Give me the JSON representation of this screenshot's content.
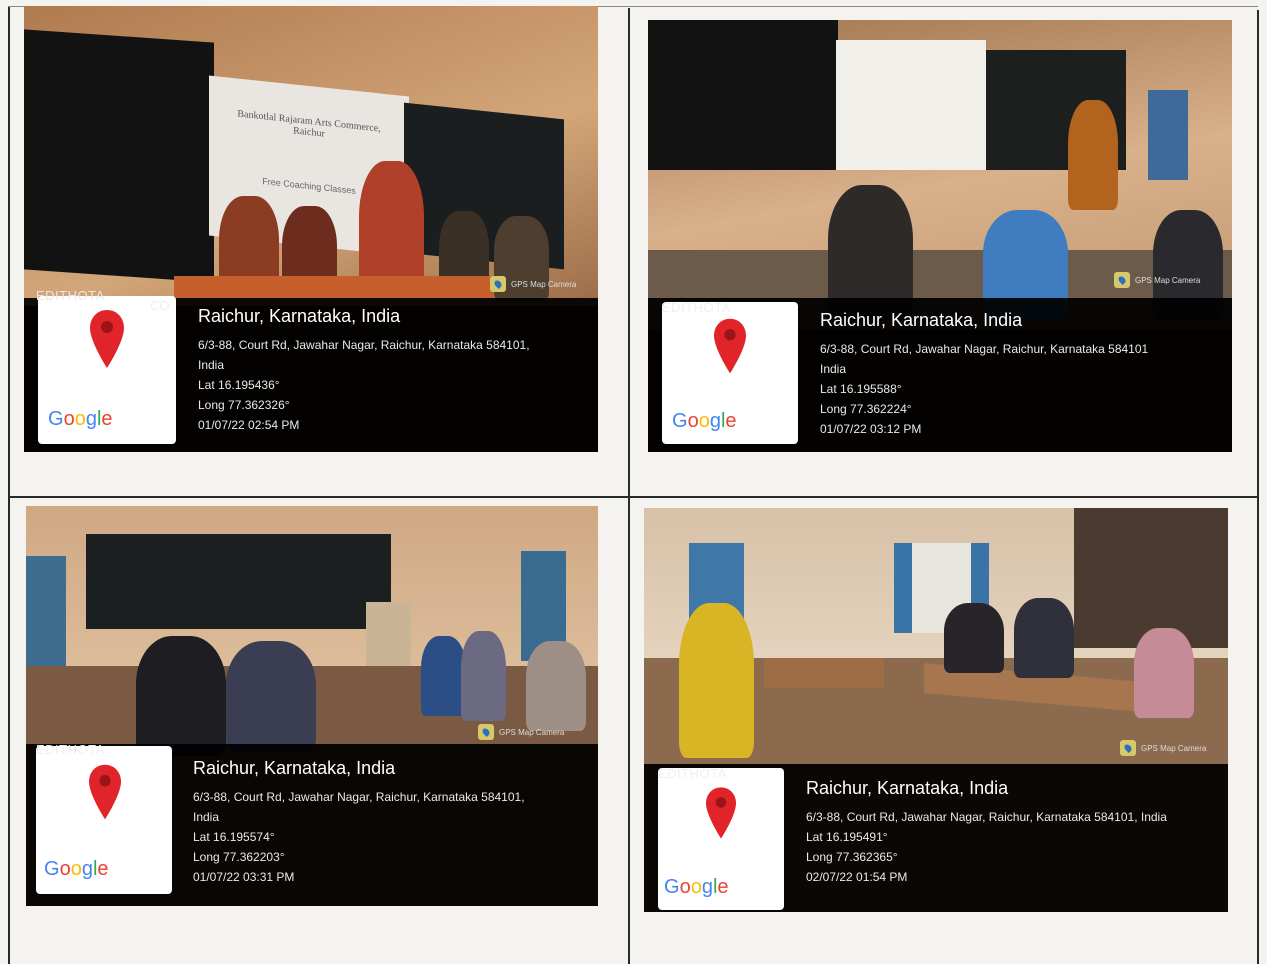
{
  "photos": [
    {
      "watermark": "EDITHOTA",
      "city": "Raichur, Karnataka, India",
      "address": "6/3-88, Court Rd, Jawahar Nagar, Raichur, Karnataka 584101,",
      "country": "India",
      "lat": "Lat 16.195436°",
      "long": "Long 77.362326°",
      "datetime": "01/07/22 02:54 PM",
      "badge": "GPS Map Camera",
      "screen_title": "Bankotlal Rajaram Arts Commerce, Raichur",
      "screen_sub": "Free Coaching Classes",
      "extra": "CO"
    },
    {
      "watermark": "EDITHOTA",
      "city": "Raichur, Karnataka, India",
      "address": "6/3-88, Court Rd, Jawahar Nagar, Raichur, Karnataka 584101",
      "country": "India",
      "lat": "Lat 16.195588°",
      "long": "Long 77.362224°",
      "datetime": "01/07/22 03:12 PM",
      "badge": "GPS Map Camera"
    },
    {
      "watermark": "EDITHOTA",
      "city": "Raichur, Karnataka, India",
      "address": "6/3-88, Court Rd, Jawahar Nagar, Raichur, Karnataka 584101,",
      "country": "India",
      "lat": "Lat 16.195574°",
      "long": "Long 77.362203°",
      "datetime": "01/07/22 03:31 PM",
      "badge": "GPS Map Camera"
    },
    {
      "watermark": "EDITHOTA",
      "city": "Raichur, Karnataka, India",
      "address": "6/3-88, Court Rd, Jawahar Nagar, Raichur, Karnataka 584101, India",
      "lat": "Lat 16.195491°",
      "long": "Long 77.362365°",
      "datetime": "02/07/22 01:54 PM",
      "badge": "GPS Map Camera"
    }
  ],
  "google_logo": "Google",
  "icons": [
    "map-pin-icon",
    "gps-map-camera-icon"
  ],
  "colors": {
    "pin": "#e0242a",
    "overlay": "#000000",
    "wall": "#b98a62"
  }
}
